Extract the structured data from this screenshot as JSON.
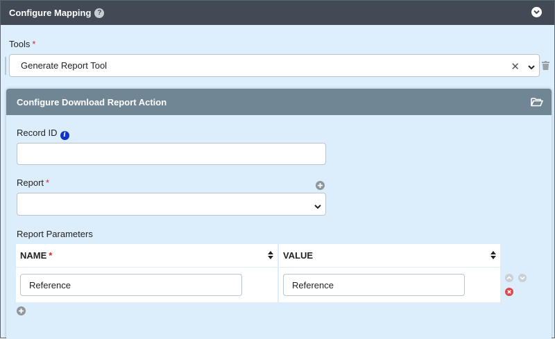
{
  "header": {
    "title": "Configure Mapping"
  },
  "tools": {
    "label": "Tools",
    "required_mark": "*",
    "selected": "Generate Report Tool"
  },
  "panel": {
    "title": "Configure Download Report Action",
    "record_id": {
      "label": "Record ID",
      "value": ""
    },
    "report": {
      "label": "Report",
      "required_mark": "*",
      "selected": ""
    },
    "parameters": {
      "label": "Report Parameters",
      "columns": [
        {
          "label": "NAME",
          "required_mark": "*"
        },
        {
          "label": "VALUE",
          "required_mark": ""
        }
      ],
      "rows": [
        {
          "name": "Reference",
          "value": "Reference"
        }
      ]
    }
  },
  "colors": {
    "header_bg": "#424a55",
    "panel_header_bg": "#718695",
    "body_bg": "#ddeefc",
    "required": "#d9232d",
    "info": "#1034c8",
    "remove": "#e0474c"
  }
}
